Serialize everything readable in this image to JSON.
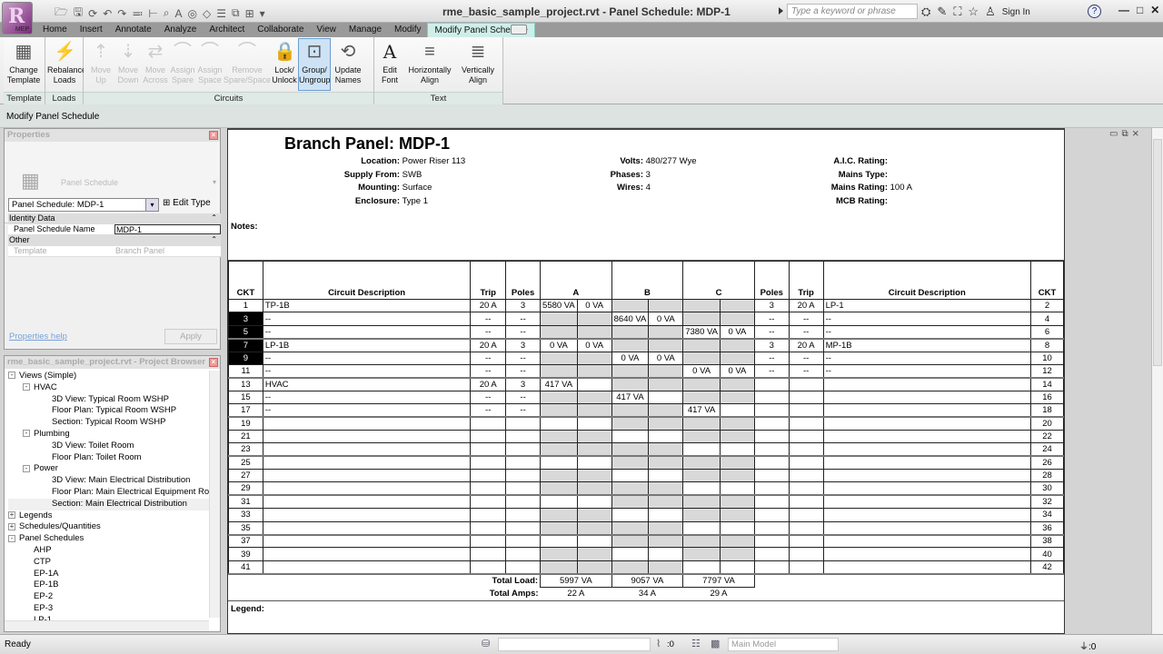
{
  "window": {
    "title": "rme_basic_sample_project.rvt - Panel Schedule: MDP-1",
    "app_badge": "MEP",
    "search_placeholder": "Type a keyword or phrase",
    "sign_in": "Sign In"
  },
  "tabs": [
    "Home",
    "Insert",
    "Annotate",
    "Analyze",
    "Architect",
    "Collaborate",
    "View",
    "Manage",
    "Modify",
    "Modify Panel Schedule"
  ],
  "active_tab": "Modify Panel Schedule",
  "ribbon": {
    "panels": [
      {
        "title": "Template",
        "buttons": [
          {
            "label": "Change Template",
            "enabled": true
          }
        ]
      },
      {
        "title": "Loads",
        "buttons": [
          {
            "label": "Rebalance Loads",
            "enabled": true
          }
        ]
      },
      {
        "title": "Circuits",
        "buttons": [
          {
            "label": "Move Up",
            "enabled": false
          },
          {
            "label": "Move Down",
            "enabled": false
          },
          {
            "label": "Move Across",
            "enabled": false
          },
          {
            "label": "Assign Spare",
            "enabled": false
          },
          {
            "label": "Assign Space",
            "enabled": false
          },
          {
            "label": "Remove Spare/Space",
            "enabled": false
          },
          {
            "label": "Lock/ Unlock",
            "enabled": true
          },
          {
            "label": "Group/ Ungroup",
            "enabled": true,
            "selected": true
          },
          {
            "label": "Update Names",
            "enabled": true
          }
        ]
      },
      {
        "title": "Text",
        "buttons": [
          {
            "label": "Edit Font",
            "enabled": true
          },
          {
            "label": "Horizontally Align",
            "enabled": true
          },
          {
            "label": "Vertically Align",
            "enabled": true
          }
        ]
      }
    ]
  },
  "context_bar": "Modify Panel Schedule",
  "properties": {
    "title": "Properties",
    "type_name": "Panel Schedule",
    "selector": "Panel Schedule: MDP-1",
    "edit_type": "Edit Type",
    "groups": [
      {
        "name": "Identity Data",
        "rows": [
          {
            "key": "Panel Schedule Name",
            "value": "MDP-1"
          }
        ]
      },
      {
        "name": "Other",
        "rows": [
          {
            "key": "Template",
            "value": "Branch Panel"
          }
        ]
      }
    ],
    "help_link": "Properties help",
    "apply": "Apply"
  },
  "project_browser": {
    "title": "rme_basic_sample_project.rvt - Project Browser",
    "nodes": [
      {
        "label": "Views (Simple)",
        "level": 0,
        "expander": "-"
      },
      {
        "label": "HVAC",
        "level": 1,
        "expander": "-"
      },
      {
        "label": "3D View: Typical Room WSHP",
        "level": 2
      },
      {
        "label": "Floor Plan: Typical Room WSHP",
        "level": 2
      },
      {
        "label": "Section: Typical Room WSHP",
        "level": 2
      },
      {
        "label": "Plumbing",
        "level": 1,
        "expander": "-"
      },
      {
        "label": "3D View: Toilet Room",
        "level": 2
      },
      {
        "label": "Floor Plan: Toilet Room",
        "level": 2
      },
      {
        "label": "Power",
        "level": 1,
        "expander": "-"
      },
      {
        "label": "3D View: Main Electrical Distribution",
        "level": 2
      },
      {
        "label": "Floor Plan: Main Electrical Equipment Roo",
        "level": 2
      },
      {
        "label": "Section: Main Electrical Distribution",
        "level": 2,
        "selected": true
      },
      {
        "label": "Legends",
        "level": 0,
        "expander": "+"
      },
      {
        "label": "Schedules/Quantities",
        "level": 0,
        "expander": "+"
      },
      {
        "label": "Panel Schedules",
        "level": 0,
        "expander": "-"
      },
      {
        "label": "AHP",
        "level": 1
      },
      {
        "label": "CTP",
        "level": 1
      },
      {
        "label": "EP-1A",
        "level": 1
      },
      {
        "label": "EP-1B",
        "level": 1
      },
      {
        "label": "EP-2",
        "level": 1
      },
      {
        "label": "EP-3",
        "level": 1
      },
      {
        "label": "LP-1",
        "level": 1
      }
    ]
  },
  "status": {
    "ready": "Ready",
    "selection_count": ":0",
    "model": "Main Model",
    "filter_count": ":0"
  },
  "panel": {
    "title": "Branch Panel: MDP-1",
    "info_left": [
      {
        "k": "Location:",
        "v": "Power Riser 113"
      },
      {
        "k": "Supply From:",
        "v": "SWB"
      },
      {
        "k": "Mounting:",
        "v": "Surface"
      },
      {
        "k": "Enclosure:",
        "v": "Type 1"
      }
    ],
    "info_mid": [
      {
        "k": "Volts:",
        "v": "480/277 Wye"
      },
      {
        "k": "Phases:",
        "v": "3"
      },
      {
        "k": "Wires:",
        "v": "4"
      }
    ],
    "info_right": [
      {
        "k": "A.I.C. Rating:",
        "v": ""
      },
      {
        "k": "Mains Type:",
        "v": ""
      },
      {
        "k": "Mains Rating:",
        "v": "100 A"
      },
      {
        "k": "MCB Rating:",
        "v": ""
      }
    ],
    "notes_label": "Notes:",
    "legend_label": "Legend:",
    "headers": {
      "ckt": "CKT",
      "desc": "Circuit Description",
      "trip": "Trip",
      "poles": "Poles",
      "a": "A",
      "b": "B",
      "c": "C"
    },
    "rows": [
      {
        "l": {
          "ckt": "1",
          "desc": "TP-1B",
          "trip": "20 A",
          "poles": "3"
        },
        "ph": [
          "5580 VA",
          "0 VA",
          "",
          "",
          "",
          "",
          ""
        ],
        "r": {
          "ckt": "2",
          "desc": "LP-1",
          "trip": "20 A",
          "poles": "3"
        }
      },
      {
        "l": {
          "ckt": "3",
          "desc": "--",
          "trip": "--",
          "poles": "--",
          "sel": true
        },
        "ph": [
          "",
          "",
          "8640 VA",
          "0 VA",
          "",
          ""
        ],
        "r": {
          "ckt": "4",
          "desc": "--",
          "trip": "--",
          "poles": "--"
        }
      },
      {
        "l": {
          "ckt": "5",
          "desc": "--",
          "trip": "--",
          "poles": "--",
          "sel": true
        },
        "ph": [
          "",
          "",
          "",
          "",
          "7380 VA",
          "0 VA"
        ],
        "r": {
          "ckt": "6",
          "desc": "--",
          "trip": "--",
          "poles": "--"
        }
      },
      {
        "l": {
          "ckt": "7",
          "desc": "LP-1B",
          "trip": "20 A",
          "poles": "3",
          "sel": true
        },
        "ph": [
          "0 VA",
          "0 VA",
          "",
          "",
          "",
          ""
        ],
        "r": {
          "ckt": "8",
          "desc": "MP-1B",
          "trip": "20 A",
          "poles": "3"
        }
      },
      {
        "l": {
          "ckt": "9",
          "desc": "--",
          "trip": "--",
          "poles": "--",
          "sel": true
        },
        "ph": [
          "",
          "",
          "0 VA",
          "0 VA",
          "",
          ""
        ],
        "r": {
          "ckt": "10",
          "desc": "--",
          "trip": "--",
          "poles": "--"
        }
      },
      {
        "l": {
          "ckt": "11",
          "desc": "--",
          "trip": "--",
          "poles": "--"
        },
        "ph": [
          "",
          "",
          "",
          "",
          "0 VA",
          "0 VA"
        ],
        "r": {
          "ckt": "12",
          "desc": "--",
          "trip": "--",
          "poles": "--"
        }
      },
      {
        "l": {
          "ckt": "13",
          "desc": "HVAC",
          "trip": "20 A",
          "poles": "3"
        },
        "ph": [
          "417 VA",
          "",
          "",
          "",
          "",
          ""
        ],
        "r": {
          "ckt": "14",
          "desc": "",
          "trip": "",
          "poles": ""
        }
      },
      {
        "l": {
          "ckt": "15",
          "desc": "--",
          "trip": "--",
          "poles": "--"
        },
        "ph": [
          "",
          "",
          "417 VA",
          "",
          "",
          ""
        ],
        "r": {
          "ckt": "16",
          "desc": "",
          "trip": "",
          "poles": ""
        }
      },
      {
        "l": {
          "ckt": "17",
          "desc": "--",
          "trip": "--",
          "poles": "--"
        },
        "ph": [
          "",
          "",
          "",
          "",
          "417 VA",
          ""
        ],
        "r": {
          "ckt": "18",
          "desc": "",
          "trip": "",
          "poles": ""
        }
      },
      {
        "l": {
          "ckt": "19",
          "desc": "",
          "trip": "",
          "poles": ""
        },
        "ph": [
          "",
          "",
          "",
          "",
          "",
          ""
        ],
        "r": {
          "ckt": "20",
          "desc": "",
          "trip": "",
          "poles": ""
        }
      },
      {
        "l": {
          "ckt": "21",
          "desc": "",
          "trip": "",
          "poles": ""
        },
        "ph": [
          "",
          "",
          "",
          "",
          "",
          ""
        ],
        "r": {
          "ckt": "22",
          "desc": "",
          "trip": "",
          "poles": ""
        }
      },
      {
        "l": {
          "ckt": "23",
          "desc": "",
          "trip": "",
          "poles": ""
        },
        "ph": [
          "",
          "",
          "",
          "",
          "",
          ""
        ],
        "r": {
          "ckt": "24",
          "desc": "",
          "trip": "",
          "poles": ""
        }
      },
      {
        "l": {
          "ckt": "25",
          "desc": "",
          "trip": "",
          "poles": ""
        },
        "ph": [
          "",
          "",
          "",
          "",
          "",
          ""
        ],
        "r": {
          "ckt": "26",
          "desc": "",
          "trip": "",
          "poles": ""
        }
      },
      {
        "l": {
          "ckt": "27",
          "desc": "",
          "trip": "",
          "poles": ""
        },
        "ph": [
          "",
          "",
          "",
          "",
          "",
          ""
        ],
        "r": {
          "ckt": "28",
          "desc": "",
          "trip": "",
          "poles": ""
        }
      },
      {
        "l": {
          "ckt": "29",
          "desc": "",
          "trip": "",
          "poles": ""
        },
        "ph": [
          "",
          "",
          "",
          "",
          "",
          ""
        ],
        "r": {
          "ckt": "30",
          "desc": "",
          "trip": "",
          "poles": ""
        }
      },
      {
        "l": {
          "ckt": "31",
          "desc": "",
          "trip": "",
          "poles": ""
        },
        "ph": [
          "",
          "",
          "",
          "",
          "",
          ""
        ],
        "r": {
          "ckt": "32",
          "desc": "",
          "trip": "",
          "poles": ""
        }
      },
      {
        "l": {
          "ckt": "33",
          "desc": "",
          "trip": "",
          "poles": ""
        },
        "ph": [
          "",
          "",
          "",
          "",
          "",
          ""
        ],
        "r": {
          "ckt": "34",
          "desc": "",
          "trip": "",
          "poles": ""
        }
      },
      {
        "l": {
          "ckt": "35",
          "desc": "",
          "trip": "",
          "poles": ""
        },
        "ph": [
          "",
          "",
          "",
          "",
          "",
          ""
        ],
        "r": {
          "ckt": "36",
          "desc": "",
          "trip": "",
          "poles": ""
        }
      },
      {
        "l": {
          "ckt": "37",
          "desc": "",
          "trip": "",
          "poles": ""
        },
        "ph": [
          "",
          "",
          "",
          "",
          "",
          ""
        ],
        "r": {
          "ckt": "38",
          "desc": "",
          "trip": "",
          "poles": ""
        }
      },
      {
        "l": {
          "ckt": "39",
          "desc": "",
          "trip": "",
          "poles": ""
        },
        "ph": [
          "",
          "",
          "",
          "",
          "",
          ""
        ],
        "r": {
          "ckt": "40",
          "desc": "",
          "trip": "",
          "poles": ""
        }
      },
      {
        "l": {
          "ckt": "41",
          "desc": "",
          "trip": "",
          "poles": ""
        },
        "ph": [
          "",
          "",
          "",
          "",
          "",
          ""
        ],
        "r": {
          "ckt": "42",
          "desc": "",
          "trip": "",
          "poles": ""
        }
      }
    ],
    "totals": {
      "load_label": "Total Load:",
      "amps_label": "Total Amps:",
      "load": [
        "5997 VA",
        "9057 VA",
        "7797 VA"
      ],
      "amps": [
        "22 A",
        "34 A",
        "29 A"
      ]
    }
  }
}
